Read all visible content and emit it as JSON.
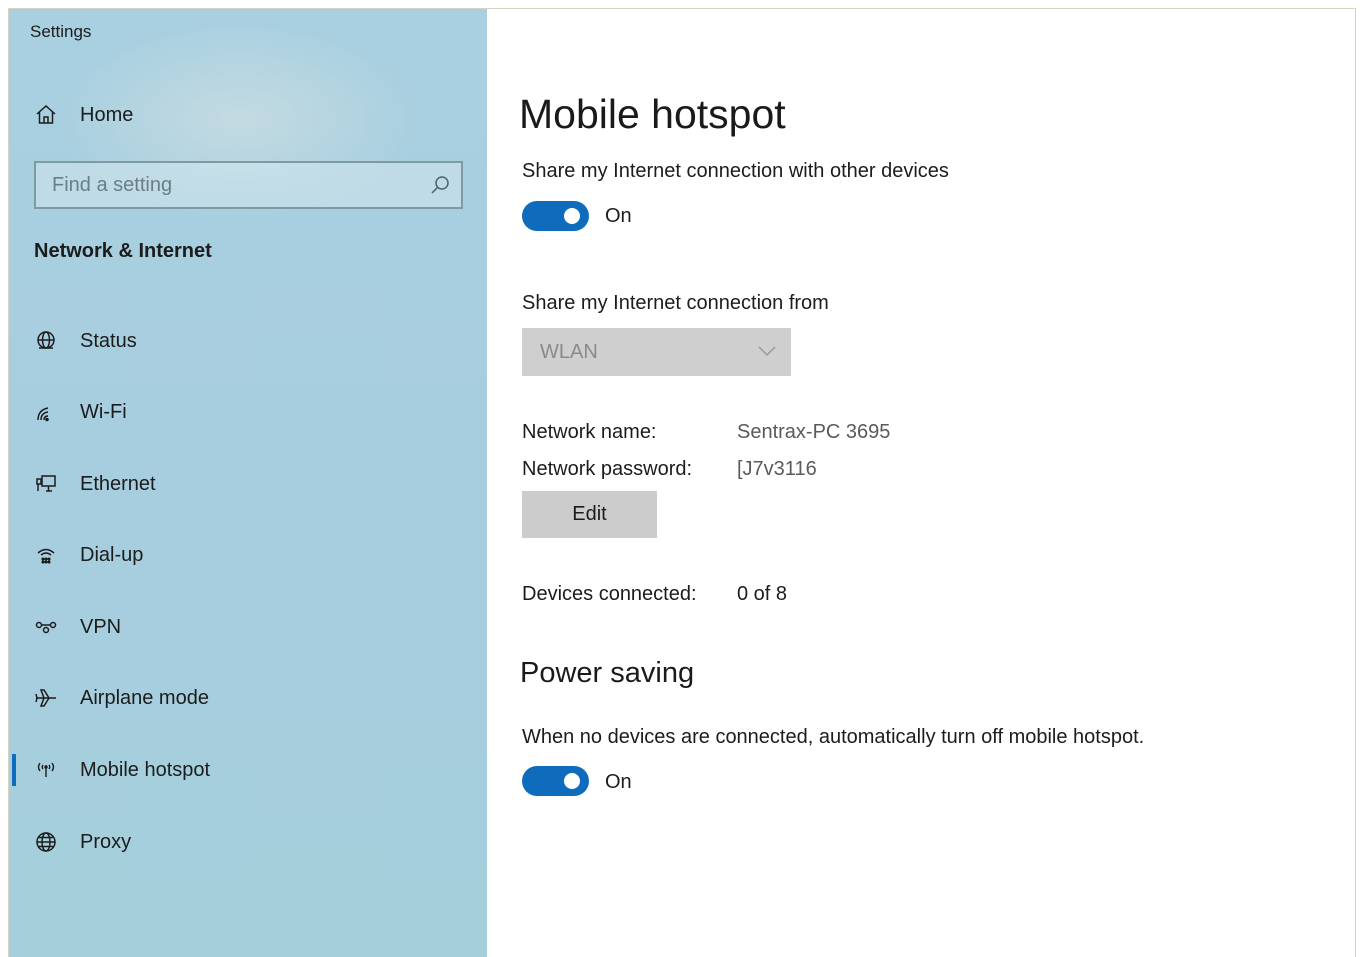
{
  "window": {
    "title": "Settings"
  },
  "sidebar": {
    "home_label": "Home",
    "search_placeholder": "Find a setting",
    "section_title": "Network & Internet",
    "items": [
      {
        "label": "Status",
        "icon": "globe-status-icon"
      },
      {
        "label": "Wi-Fi",
        "icon": "wifi-icon"
      },
      {
        "label": "Ethernet",
        "icon": "ethernet-icon"
      },
      {
        "label": "Dial-up",
        "icon": "dialup-icon"
      },
      {
        "label": "VPN",
        "icon": "vpn-icon"
      },
      {
        "label": "Airplane mode",
        "icon": "airplane-icon"
      },
      {
        "label": "Mobile hotspot",
        "icon": "hotspot-icon",
        "selected": true
      },
      {
        "label": "Proxy",
        "icon": "globe-icon"
      }
    ]
  },
  "main": {
    "title": "Mobile hotspot",
    "share_connection": {
      "label": "Share my Internet connection with other devices",
      "state": "On",
      "on": true
    },
    "share_from": {
      "label": "Share my Internet connection from",
      "selected": "WLAN"
    },
    "network_name": {
      "label": "Network name:",
      "value": "Sentrax-PC 3695"
    },
    "network_password": {
      "label": "Network password:",
      "value": "[J7v3116"
    },
    "edit_label": "Edit",
    "devices_connected": {
      "label": "Devices connected:",
      "value": "0 of 8"
    },
    "power_saving": {
      "heading": "Power saving",
      "description": "When no devices are connected, automatically turn off mobile hotspot.",
      "state": "On",
      "on": true
    }
  },
  "colors": {
    "accent": "#0f6cbd",
    "sidebar_bg": "#a8cfdf"
  }
}
